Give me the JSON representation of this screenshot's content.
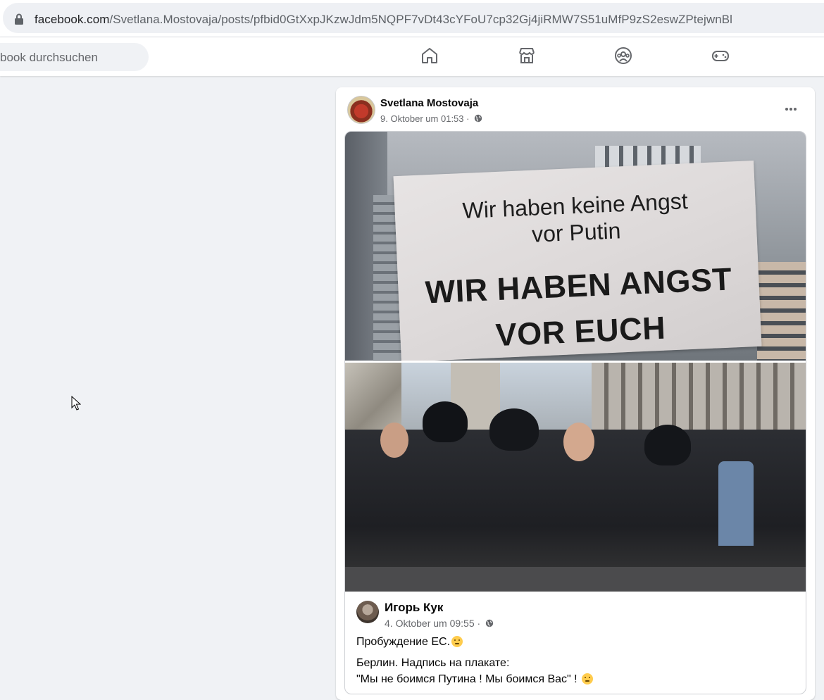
{
  "browser": {
    "url_host": "facebook.com",
    "url_path": "/Svetlana.Mostovaja/posts/pfbid0GtXxpJKzwJdm5NQPF7vDt43cYFoU7cp32Gj4jiRMW7S51uMfP9zS2eswZPtejwnBl"
  },
  "header": {
    "search_text": "book durchsuchen",
    "nav_icons": [
      "home-icon",
      "marketplace-icon",
      "groups-icon",
      "gaming-icon"
    ]
  },
  "post": {
    "author": "Svetlana Mostovaja",
    "timestamp": "9. Oktober um 01:53 ·",
    "photo1_sign": {
      "line1": "Wir haben keine Angst",
      "line2": "vor Putin",
      "line3": "WIR HABEN ANGST",
      "line4": "VOR EUCH"
    },
    "shared": {
      "author": "Игорь Кук",
      "timestamp": "4. Oktober um 09:55 ·",
      "text_line1": "Пробуждение ЕС.",
      "text_line2": "Берлин. Надпись на плакате:",
      "text_line3": "\"Мы не боимся Путина ! Мы боимся Вас\" !"
    }
  },
  "colors": {
    "page_bg": "#f0f2f5",
    "text_secondary": "#65676b",
    "icon_gray": "#65676b"
  }
}
